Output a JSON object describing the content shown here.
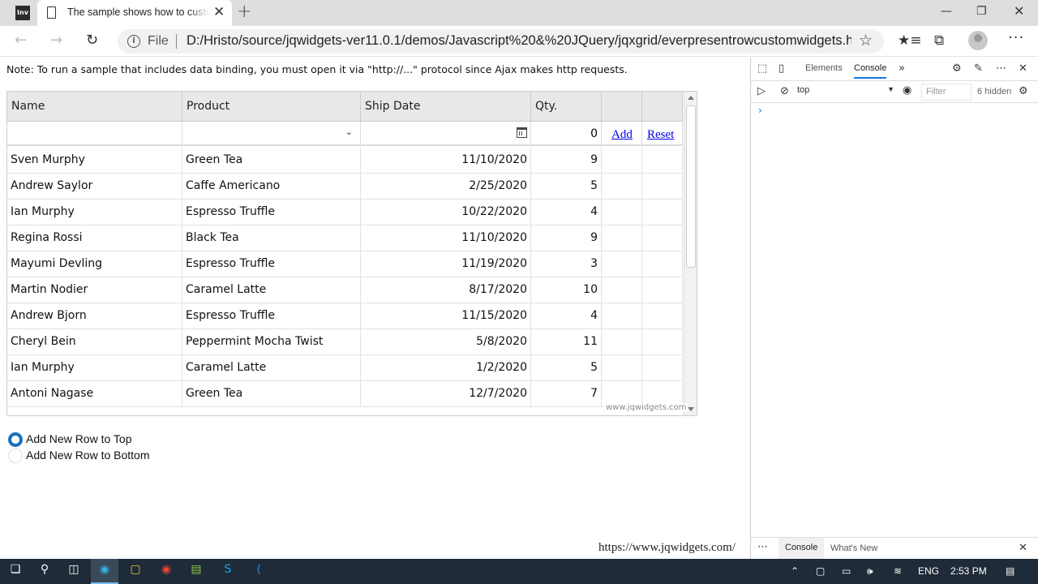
{
  "browser": {
    "app_icon_label": "Inv",
    "tab_title": "The sample shows how to customize",
    "tab_close_glyph": "✕",
    "new_tab_glyph": "+",
    "file_label": "File",
    "url": "D:/Hristo/source/jqwidgets-ver11.0.1/demos/Javascript%20&%20JQuery/jqxgrid/everpresentrowcustomwidgets.h..."
  },
  "page": {
    "note": "Note: To run a sample that includes data binding, you must open it via \"http://...\" protocol since Ajax makes http requests.",
    "grid": {
      "columns": [
        "Name",
        "Product",
        "Ship Date",
        "Qty."
      ],
      "filter_row": {
        "qty_value": "0",
        "add_label": "Add",
        "reset_label": "Reset"
      },
      "rows": [
        [
          "Sven Murphy",
          "Green Tea",
          "11/10/2020",
          "9"
        ],
        [
          "Andrew Saylor",
          "Caffe Americano",
          "2/25/2020",
          "5"
        ],
        [
          "Ian Murphy",
          "Espresso Truffle",
          "10/22/2020",
          "4"
        ],
        [
          "Regina Rossi",
          "Black Tea",
          "11/10/2020",
          "9"
        ],
        [
          "Mayumi Devling",
          "Espresso Truffle",
          "11/19/2020",
          "3"
        ],
        [
          "Martin Nodier",
          "Caramel Latte",
          "8/17/2020",
          "10"
        ],
        [
          "Andrew Bjorn",
          "Espresso Truffle",
          "11/15/2020",
          "4"
        ],
        [
          "Cheryl Bein",
          "Peppermint Mocha Twist",
          "5/8/2020",
          "11"
        ],
        [
          "Ian Murphy",
          "Caramel Latte",
          "1/2/2020",
          "5"
        ],
        [
          "Antoni Nagase",
          "Green Tea",
          "12/7/2020",
          "7"
        ]
      ],
      "watermark": "www.jqwidgets.com"
    },
    "radio_options": [
      {
        "label": "Add New Row to Top",
        "selected": true
      },
      {
        "label": "Add New Row to Bottom",
        "selected": false
      }
    ],
    "status_url": "https://www.jqwidgets.com/"
  },
  "devtools": {
    "tabs": [
      "Elements",
      "Console"
    ],
    "active_tab": "Console",
    "context": "top",
    "filter_placeholder": "Filter",
    "hidden_count": "6 hidden",
    "prompt_glyph": "›",
    "drawer_tabs": [
      "Console",
      "What's New"
    ]
  },
  "taskbar": {
    "language": "ENG",
    "time": "2:53 PM"
  },
  "colors": {
    "accent": "#1d6fb8",
    "link": "#0000ee",
    "taskbar": "#1f2b38"
  }
}
